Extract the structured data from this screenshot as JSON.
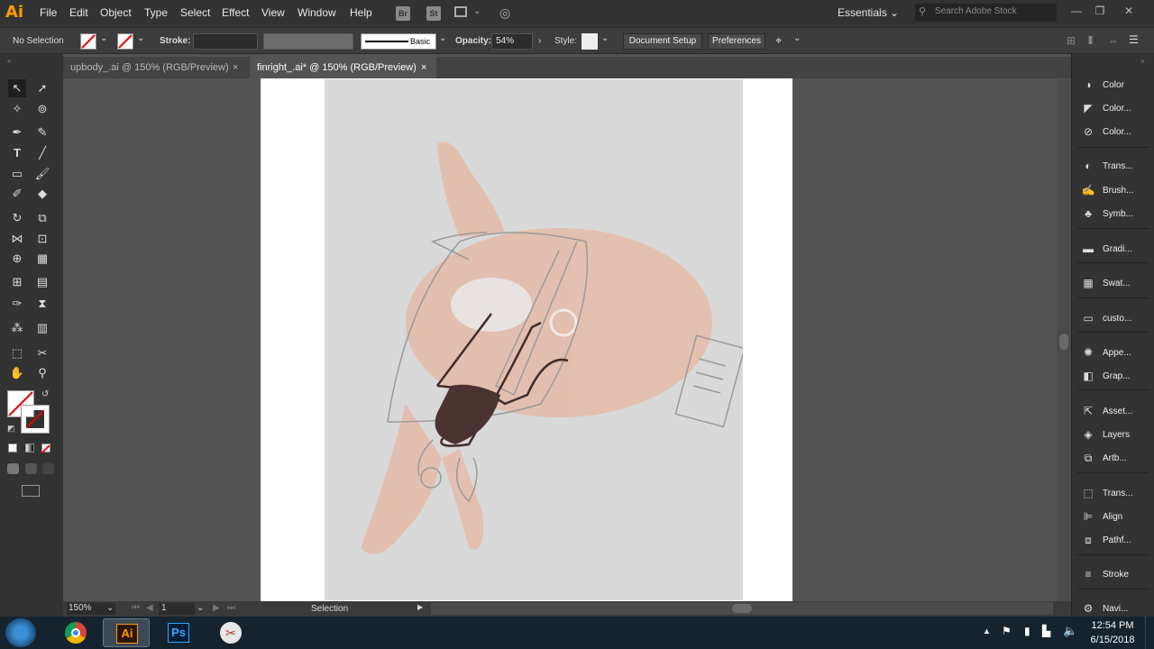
{
  "app": {
    "logo": "Ai"
  },
  "menu": [
    "File",
    "Edit",
    "Object",
    "Type",
    "Select",
    "Effect",
    "View",
    "Window",
    "Help"
  ],
  "bridge": {
    "br": "Br",
    "st": "St"
  },
  "workspace": "Essentials",
  "search_placeholder": "Search Adobe Stock",
  "control": {
    "selection": "No Selection",
    "stroke_label": "Stroke:",
    "brush_label": "Basic",
    "opacity_label": "Opacity:",
    "opacity_value": "54%",
    "style_label": "Style:",
    "doc_setup": "Document Setup",
    "preferences": "Preferences"
  },
  "tabs": [
    {
      "label": "upbody_.ai @ 150% (RGB/Preview)",
      "close": "×"
    },
    {
      "label": "finright_.ai* @ 150% (RGB/Preview)",
      "close": "×"
    }
  ],
  "panels": [
    {
      "label": "Color",
      "icon": "color-icon"
    },
    {
      "label": "Color...",
      "icon": "color-guide-icon"
    },
    {
      "label": "Color...",
      "icon": "color-theme-icon"
    },
    {
      "label": "Trans...",
      "icon": "transparency-icon"
    },
    {
      "label": "Brush...",
      "icon": "brush-icon"
    },
    {
      "label": "Symb...",
      "icon": "symbols-icon"
    },
    {
      "label": "Gradi...",
      "icon": "gradient-icon"
    },
    {
      "label": "Swat...",
      "icon": "swatches-icon"
    },
    {
      "label": "custo...",
      "icon": "custom-icon"
    },
    {
      "label": "Appe...",
      "icon": "appearance-icon"
    },
    {
      "label": "Grap...",
      "icon": "graphic-styles-icon"
    },
    {
      "label": "Asset...",
      "icon": "asset-export-icon"
    },
    {
      "label": "Layers",
      "icon": "layers-icon"
    },
    {
      "label": "Artb...",
      "icon": "artboards-icon"
    },
    {
      "label": "Trans...",
      "icon": "transform-icon"
    },
    {
      "label": "Align",
      "icon": "align-icon"
    },
    {
      "label": "Pathf...",
      "icon": "pathfinder-icon"
    },
    {
      "label": "Stroke",
      "icon": "stroke-icon"
    },
    {
      "label": "Navi...",
      "icon": "navigator-icon"
    }
  ],
  "status": {
    "zoom": "150%",
    "page": "1",
    "tool": "Selection"
  },
  "taskbar": {
    "time": "12:54 PM",
    "date": "6/15/2018",
    "ai": "Ai",
    "ps": "Ps"
  },
  "colors": {
    "accent": "#ff9a00",
    "panel": "#323232",
    "canvas": "#535353"
  }
}
